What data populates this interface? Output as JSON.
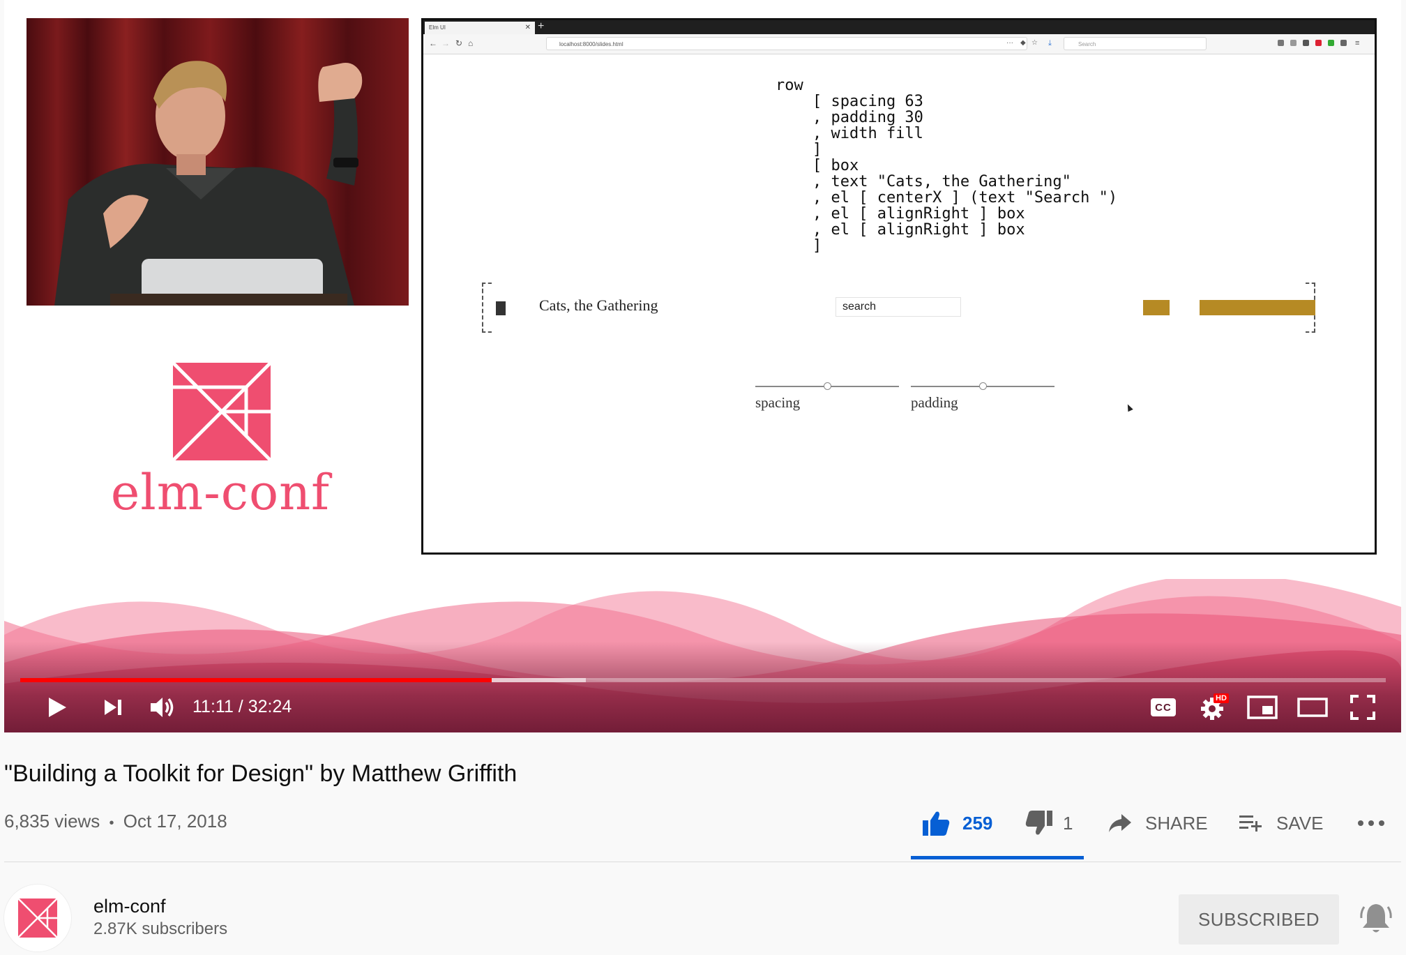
{
  "colors": {
    "brand_pink": "#ef4e70",
    "progress_red": "#ff0000",
    "like_blue": "#065fd4",
    "gold_box": "#b68a24"
  },
  "player": {
    "logo_text": "elm-conf",
    "slide": {
      "browser_tab_title": "Elm UI",
      "url": "localhost:8000/slides.html",
      "search_placeholder": "Search",
      "code": "row\n    [ spacing 63\n    , padding 30\n    , width fill\n    ]\n    [ box\n    , text \"Cats, the Gathering\"\n    , el [ centerX ] (text \"Search \")\n    , el [ alignRight ] box\n    , el [ alignRight ] box\n    ]",
      "demo_title": "Cats, the Gathering",
      "demo_search": "search",
      "sliders": [
        {
          "label": "spacing",
          "value": 0.5
        },
        {
          "label": "padding",
          "value": 0.5
        }
      ]
    },
    "controls": {
      "time_current": "11:11",
      "time_separator": " / ",
      "time_total": "32:24",
      "played_fraction": 0.345,
      "buffered_fraction": 0.414,
      "cc_label": "CC",
      "hd_badge": "HD",
      "icons": [
        "play-icon",
        "next-icon",
        "volume-icon",
        "captions-icon",
        "settings-icon",
        "miniplayer-icon",
        "theater-icon",
        "fullscreen-icon"
      ]
    }
  },
  "video": {
    "title": "\"Building a Toolkit for Design\" by Matthew Griffith",
    "views": "6,835 views",
    "separator": "•",
    "date": "Oct 17, 2018"
  },
  "actions": {
    "like_count": "259",
    "dislike_count": "1",
    "share_label": "SHARE",
    "save_label": "SAVE"
  },
  "channel": {
    "name": "elm-conf",
    "subscribers": "2.87K subscribers",
    "subscribed_label": "SUBSCRIBED"
  }
}
